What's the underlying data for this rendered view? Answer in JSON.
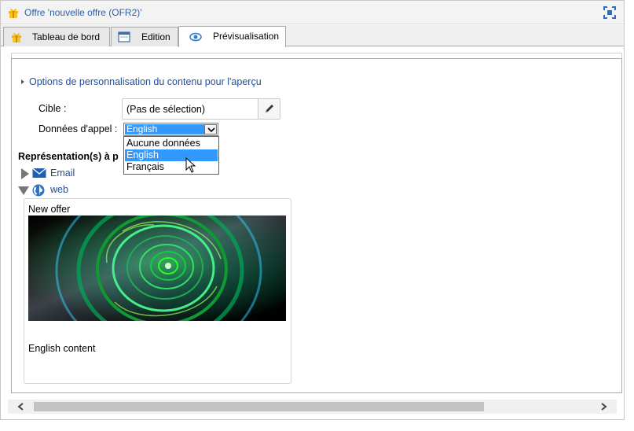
{
  "window": {
    "title": "Offre 'nouvelle offre (OFR2)'"
  },
  "tabs": [
    {
      "label": "Tableau de bord",
      "icon": "gift-icon",
      "active": false
    },
    {
      "label": "Edition",
      "icon": "window-icon",
      "active": false
    },
    {
      "label": "Prévisualisation",
      "icon": "eye-icon",
      "active": true
    }
  ],
  "options": {
    "section_label": "Options de personnalisation du contenu pour l'aperçu",
    "target_label": "Cible :",
    "target_value": "(Pas de sélection)",
    "call_data_label": "Données d'appel :",
    "call_data_selected": "English",
    "call_data_options": [
      "Aucune données",
      "English",
      "Français"
    ],
    "highlighted_option_index": 1
  },
  "representations": {
    "heading": "Représentation(s) à p",
    "items": [
      {
        "label": "Email",
        "icon": "envelope-icon",
        "expanded": false
      },
      {
        "label": "web",
        "icon": "globe-icon",
        "expanded": true
      }
    ]
  },
  "preview": {
    "title": "New offer",
    "body": "English content"
  },
  "colors": {
    "link": "#1f4e9a",
    "title": "#2d5fa8",
    "highlight": "#3399ff",
    "accent_orange": "#f0a500"
  }
}
